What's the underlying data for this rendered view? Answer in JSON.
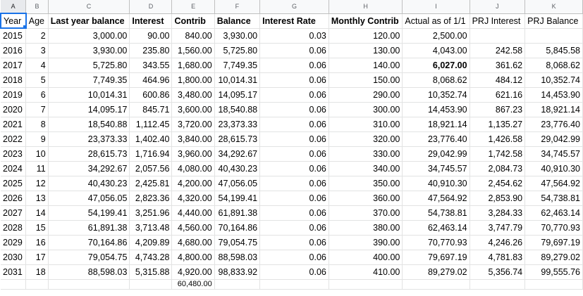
{
  "columns": [
    "A",
    "B",
    "C",
    "D",
    "E",
    "F",
    "G",
    "H",
    "I",
    "J",
    "K"
  ],
  "headers": {
    "year": "Year",
    "age": "Age",
    "last_year_balance": "Last year balance",
    "interest": "Interest",
    "contrib": "Contrib",
    "balance": "Balance",
    "interest_rate": "Interest Rate",
    "monthly_contrib": "Monthly Contrib",
    "actual": "Actual as of 1/1",
    "prj_interest": "PRJ Interest",
    "prj_balance": "PRJ Balance"
  },
  "rows": [
    [
      "2015",
      "2",
      "3,000.00",
      "90.00",
      "840.00",
      "3,930.00",
      "0.03",
      "120.00",
      "2,500.00",
      "",
      ""
    ],
    [
      "2016",
      "3",
      "3,930.00",
      "235.80",
      "1,560.00",
      "5,725.80",
      "0.06",
      "130.00",
      "4,043.00",
      "242.58",
      "5,845.58"
    ],
    [
      "2017",
      "4",
      "5,725.80",
      "343.55",
      "1,680.00",
      "7,749.35",
      "0.06",
      "140.00",
      "6,027.00",
      "361.62",
      "8,068.62"
    ],
    [
      "2018",
      "5",
      "7,749.35",
      "464.96",
      "1,800.00",
      "10,014.31",
      "0.06",
      "150.00",
      "8,068.62",
      "484.12",
      "10,352.74"
    ],
    [
      "2019",
      "6",
      "10,014.31",
      "600.86",
      "3,480.00",
      "14,095.17",
      "0.06",
      "290.00",
      "10,352.74",
      "621.16",
      "14,453.90"
    ],
    [
      "2020",
      "7",
      "14,095.17",
      "845.71",
      "3,600.00",
      "18,540.88",
      "0.06",
      "300.00",
      "14,453.90",
      "867.23",
      "18,921.14"
    ],
    [
      "2021",
      "8",
      "18,540.88",
      "1,112.45",
      "3,720.00",
      "23,373.33",
      "0.06",
      "310.00",
      "18,921.14",
      "1,135.27",
      "23,776.40"
    ],
    [
      "2022",
      "9",
      "23,373.33",
      "1,402.40",
      "3,840.00",
      "28,615.73",
      "0.06",
      "320.00",
      "23,776.40",
      "1,426.58",
      "29,042.99"
    ],
    [
      "2023",
      "10",
      "28,615.73",
      "1,716.94",
      "3,960.00",
      "34,292.67",
      "0.06",
      "330.00",
      "29,042.99",
      "1,742.58",
      "34,745.57"
    ],
    [
      "2024",
      "11",
      "34,292.67",
      "2,057.56",
      "4,080.00",
      "40,430.23",
      "0.06",
      "340.00",
      "34,745.57",
      "2,084.73",
      "40,910.30"
    ],
    [
      "2025",
      "12",
      "40,430.23",
      "2,425.81",
      "4,200.00",
      "47,056.05",
      "0.06",
      "350.00",
      "40,910.30",
      "2,454.62",
      "47,564.92"
    ],
    [
      "2026",
      "13",
      "47,056.05",
      "2,823.36",
      "4,320.00",
      "54,199.41",
      "0.06",
      "360.00",
      "47,564.92",
      "2,853.90",
      "54,738.81"
    ],
    [
      "2027",
      "14",
      "54,199.41",
      "3,251.96",
      "4,440.00",
      "61,891.38",
      "0.06",
      "370.00",
      "54,738.81",
      "3,284.33",
      "62,463.14"
    ],
    [
      "2028",
      "15",
      "61,891.38",
      "3,713.48",
      "4,560.00",
      "70,164.86",
      "0.06",
      "380.00",
      "62,463.14",
      "3,747.79",
      "70,770.93"
    ],
    [
      "2029",
      "16",
      "70,164.86",
      "4,209.89",
      "4,680.00",
      "79,054.75",
      "0.06",
      "390.00",
      "70,770.93",
      "4,246.26",
      "79,697.19"
    ],
    [
      "2030",
      "17",
      "79,054.75",
      "4,743.28",
      "4,800.00",
      "88,598.03",
      "0.06",
      "400.00",
      "79,697.19",
      "4,781.83",
      "89,279.02"
    ],
    [
      "2031",
      "18",
      "88,598.03",
      "5,315.88",
      "4,920.00",
      "98,833.92",
      "0.06",
      "410.00",
      "89,279.02",
      "5,356.74",
      "99,555.76"
    ]
  ],
  "bold_cell": {
    "row": 2,
    "col": 8
  },
  "partial_row": [
    "",
    "",
    "",
    "",
    "60,480.00",
    "",
    "",
    "",
    "",
    "",
    ""
  ]
}
